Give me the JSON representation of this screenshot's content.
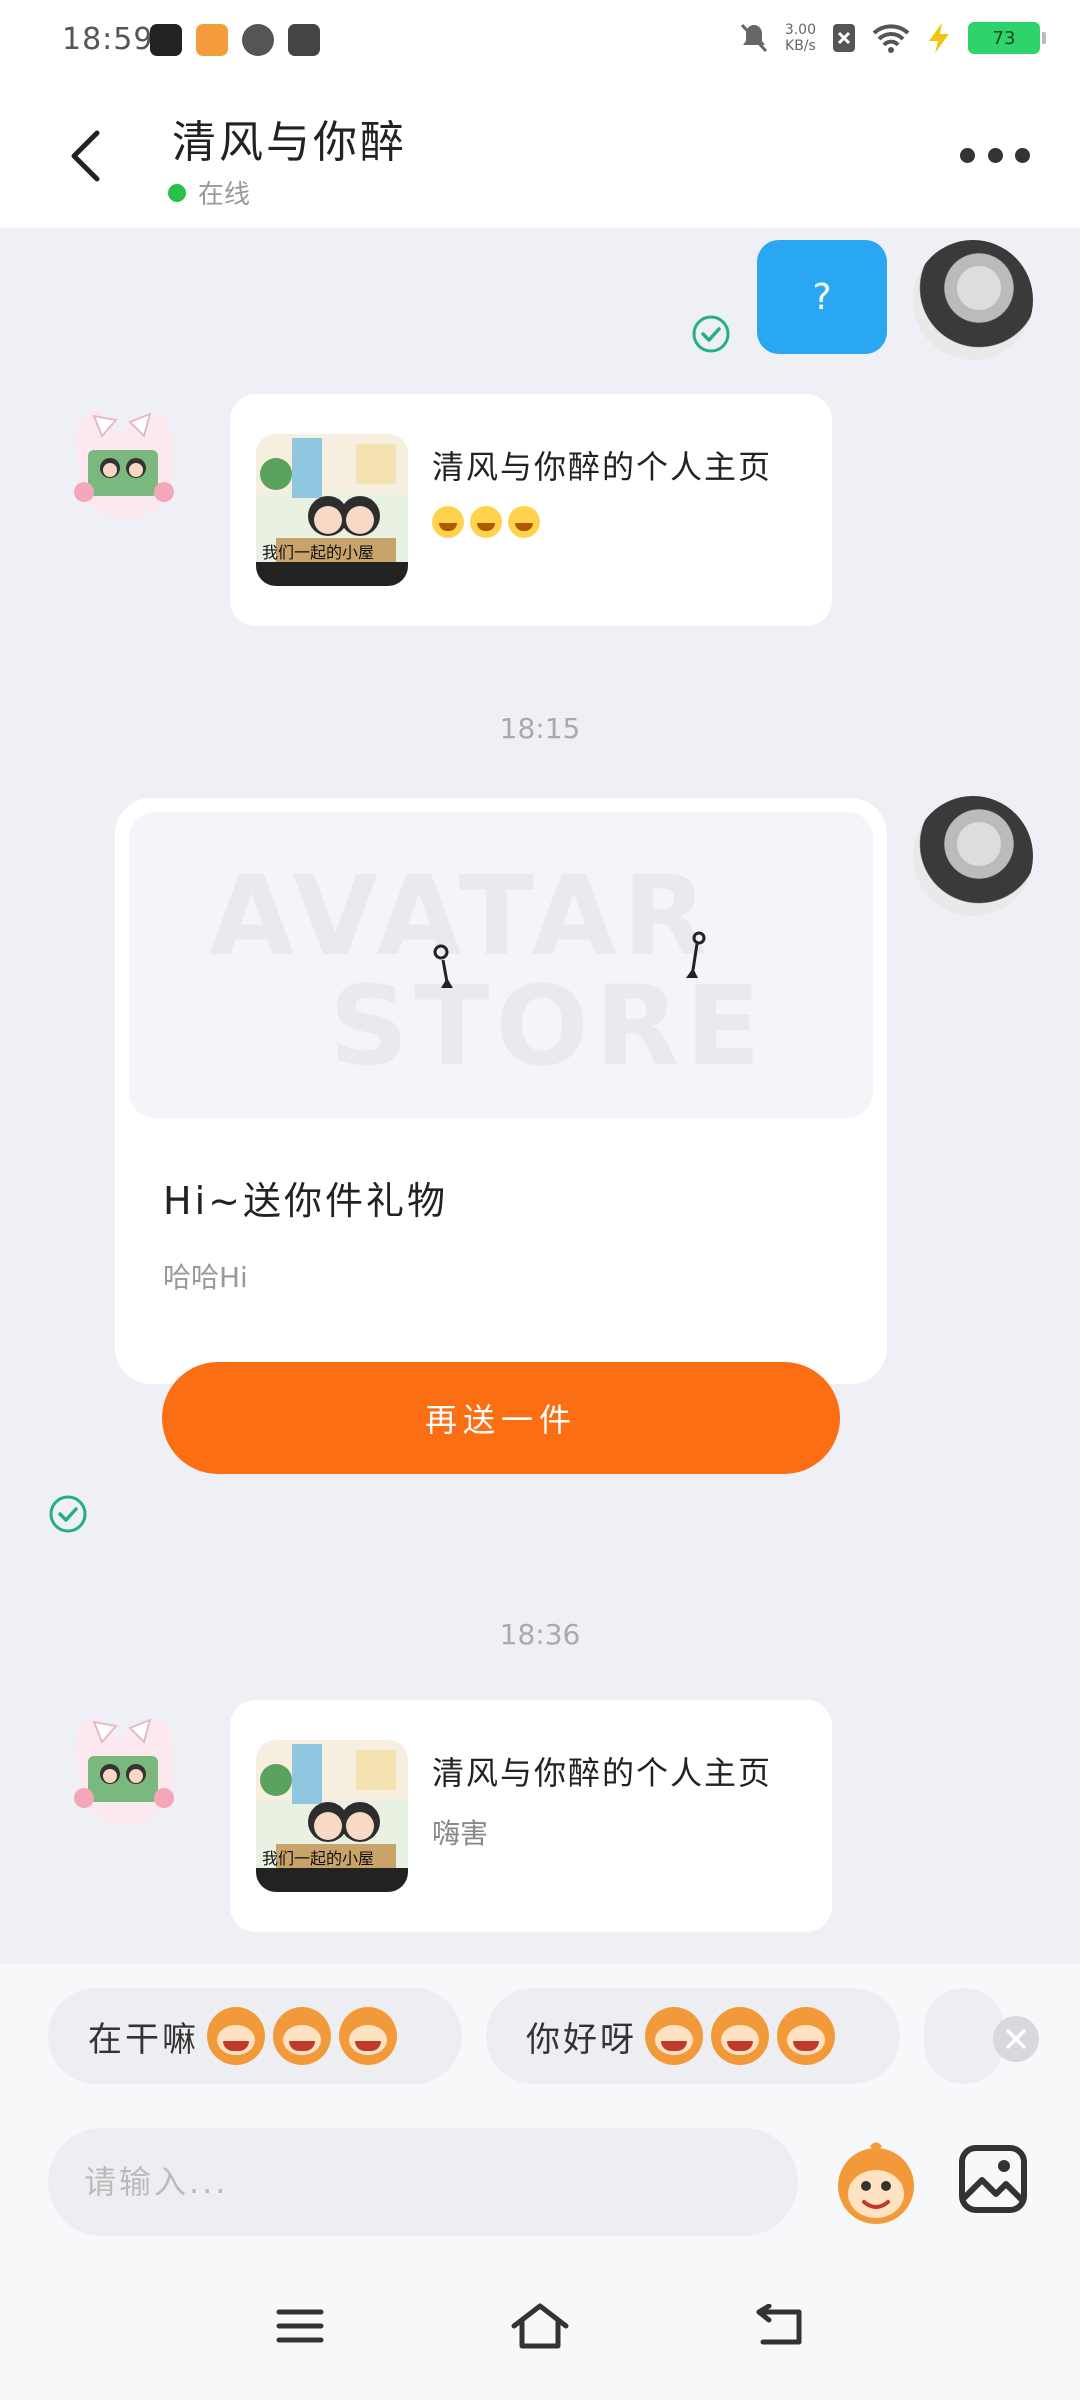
{
  "status_bar": {
    "time": "18:59",
    "net_speed_value": "3.00",
    "net_speed_unit": "KB/s",
    "battery": "73"
  },
  "header": {
    "title": "清风与你醉",
    "status": "在线"
  },
  "messages": {
    "m1_text": "?",
    "card1": {
      "title": "清风与你醉的个人主页",
      "thumb_caption": "我们一起的小屋"
    },
    "time1": "18:15",
    "gift": {
      "watermark_line1": "AVATAR",
      "watermark_line2": "STORE",
      "title": "Hi~送你件礼物",
      "subtitle": "哈哈Hi",
      "button": "再送一件"
    },
    "time2": "18:36",
    "card2": {
      "title": "清风与你醉的个人主页",
      "subtitle": "嗨害",
      "thumb_caption": "我们一起的小屋"
    }
  },
  "quick_replies": [
    "在干嘛",
    "你好呀"
  ],
  "input": {
    "placeholder": "请输入..."
  },
  "colors": {
    "accent_blue": "#29a7f2",
    "accent_orange": "#fb6e14",
    "online_green": "#27c24c",
    "check_green": "#22b07d"
  }
}
